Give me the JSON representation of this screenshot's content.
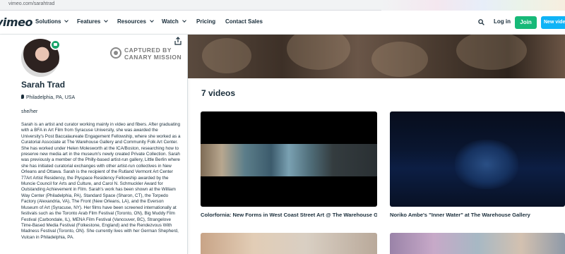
{
  "browser": {
    "url": "vimeo.com/sarahtrad"
  },
  "nav": {
    "logo": "vimeo",
    "items": [
      {
        "label": "Solutions",
        "dropdown": true
      },
      {
        "label": "Features",
        "dropdown": true
      },
      {
        "label": "Resources",
        "dropdown": true
      },
      {
        "label": "Watch",
        "dropdown": true
      },
      {
        "label": "Pricing",
        "dropdown": false
      },
      {
        "label": "Contact Sales",
        "dropdown": false
      }
    ],
    "login_label": "Log in",
    "join_label": "Join",
    "new_video_label": "New video",
    "colors": {
      "join": "#17b978",
      "new_video": "#0fb3f6"
    }
  },
  "watermark": {
    "line1": "CAPTURED BY",
    "line2": "CANARY MISSION"
  },
  "profile": {
    "name": "Sarah Trad",
    "location": "Philadelphia, PA, USA",
    "pronouns": "she/her",
    "bio": "Sarah is an artist and curator working mainly in video and fibers. After graduating with a BFA in Art Film from Syracuse University, she was awarded the University's Post Baccalaureate Engagement Fellowship, where she worked as a Curatorial Associate at The Warehouse Gallery and Community Folk Art Center. She has worked under Helen Molesworth at the ICA/Boston, researching how to preserve new media art in the museum's newly created Private Collection. Sarah was previously a member of the Philly-based artist-run gallery, Little Berlin where she has initiated curatorial exchanges with other artist-run collectives in New Orleans and Ottawa. Sarah is the recipient of the Rutland Vermont Art Center 77Art Artist Residency, the Plyspace Residency Fellowship awarded by the Muncie Council for Arts and Culture, and Carol N. Schmuckler Award for Outstanding Achievement in Film. Sarah's work has been shown at the William Way Center (Philadelphia, PA), Standard Space (Sharon, CT), the Torpedo Factory (Alexandria, VA), The Front (New Orleans, LA), and the Everson Museum of Art (Syracuse, NY). Her films have been screened internationally at festivals such as the Toronto Arab Film Festival (Toronto, ON), Big Muddy Film Festival (Carbondale, IL), MENA Film Festival (Vancouver, BC), Strangelove Time-Based Media Festival (Folkestone, England) and the Rendezvous With Madness Festival (Toronto, ON). She currently lives with her German Shepherd, Vulcan in Philadelphia, PA."
  },
  "videos": {
    "count_label": "7 videos",
    "items": [
      {
        "title": "Colorfornia: New Forms in West Coast Street Art @ The Warehouse Gal..."
      },
      {
        "title": "Noriko Ambe's \"Inner Water\" at The Warehouse Gallery"
      }
    ]
  }
}
